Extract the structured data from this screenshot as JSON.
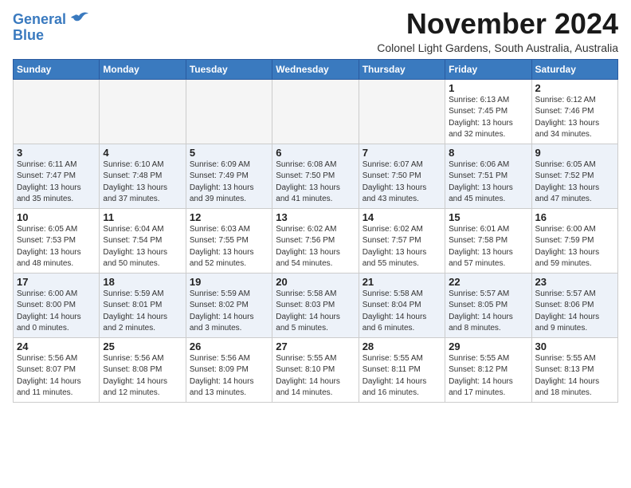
{
  "header": {
    "logo_line1": "General",
    "logo_line2": "Blue",
    "month": "November 2024",
    "location": "Colonel Light Gardens, South Australia, Australia"
  },
  "weekdays": [
    "Sunday",
    "Monday",
    "Tuesday",
    "Wednesday",
    "Thursday",
    "Friday",
    "Saturday"
  ],
  "weeks": [
    [
      {
        "day": "",
        "info": ""
      },
      {
        "day": "",
        "info": ""
      },
      {
        "day": "",
        "info": ""
      },
      {
        "day": "",
        "info": ""
      },
      {
        "day": "",
        "info": ""
      },
      {
        "day": "1",
        "info": "Sunrise: 6:13 AM\nSunset: 7:45 PM\nDaylight: 13 hours\nand 32 minutes."
      },
      {
        "day": "2",
        "info": "Sunrise: 6:12 AM\nSunset: 7:46 PM\nDaylight: 13 hours\nand 34 minutes."
      }
    ],
    [
      {
        "day": "3",
        "info": "Sunrise: 6:11 AM\nSunset: 7:47 PM\nDaylight: 13 hours\nand 35 minutes."
      },
      {
        "day": "4",
        "info": "Sunrise: 6:10 AM\nSunset: 7:48 PM\nDaylight: 13 hours\nand 37 minutes."
      },
      {
        "day": "5",
        "info": "Sunrise: 6:09 AM\nSunset: 7:49 PM\nDaylight: 13 hours\nand 39 minutes."
      },
      {
        "day": "6",
        "info": "Sunrise: 6:08 AM\nSunset: 7:50 PM\nDaylight: 13 hours\nand 41 minutes."
      },
      {
        "day": "7",
        "info": "Sunrise: 6:07 AM\nSunset: 7:50 PM\nDaylight: 13 hours\nand 43 minutes."
      },
      {
        "day": "8",
        "info": "Sunrise: 6:06 AM\nSunset: 7:51 PM\nDaylight: 13 hours\nand 45 minutes."
      },
      {
        "day": "9",
        "info": "Sunrise: 6:05 AM\nSunset: 7:52 PM\nDaylight: 13 hours\nand 47 minutes."
      }
    ],
    [
      {
        "day": "10",
        "info": "Sunrise: 6:05 AM\nSunset: 7:53 PM\nDaylight: 13 hours\nand 48 minutes."
      },
      {
        "day": "11",
        "info": "Sunrise: 6:04 AM\nSunset: 7:54 PM\nDaylight: 13 hours\nand 50 minutes."
      },
      {
        "day": "12",
        "info": "Sunrise: 6:03 AM\nSunset: 7:55 PM\nDaylight: 13 hours\nand 52 minutes."
      },
      {
        "day": "13",
        "info": "Sunrise: 6:02 AM\nSunset: 7:56 PM\nDaylight: 13 hours\nand 54 minutes."
      },
      {
        "day": "14",
        "info": "Sunrise: 6:02 AM\nSunset: 7:57 PM\nDaylight: 13 hours\nand 55 minutes."
      },
      {
        "day": "15",
        "info": "Sunrise: 6:01 AM\nSunset: 7:58 PM\nDaylight: 13 hours\nand 57 minutes."
      },
      {
        "day": "16",
        "info": "Sunrise: 6:00 AM\nSunset: 7:59 PM\nDaylight: 13 hours\nand 59 minutes."
      }
    ],
    [
      {
        "day": "17",
        "info": "Sunrise: 6:00 AM\nSunset: 8:00 PM\nDaylight: 14 hours\nand 0 minutes."
      },
      {
        "day": "18",
        "info": "Sunrise: 5:59 AM\nSunset: 8:01 PM\nDaylight: 14 hours\nand 2 minutes."
      },
      {
        "day": "19",
        "info": "Sunrise: 5:59 AM\nSunset: 8:02 PM\nDaylight: 14 hours\nand 3 minutes."
      },
      {
        "day": "20",
        "info": "Sunrise: 5:58 AM\nSunset: 8:03 PM\nDaylight: 14 hours\nand 5 minutes."
      },
      {
        "day": "21",
        "info": "Sunrise: 5:58 AM\nSunset: 8:04 PM\nDaylight: 14 hours\nand 6 minutes."
      },
      {
        "day": "22",
        "info": "Sunrise: 5:57 AM\nSunset: 8:05 PM\nDaylight: 14 hours\nand 8 minutes."
      },
      {
        "day": "23",
        "info": "Sunrise: 5:57 AM\nSunset: 8:06 PM\nDaylight: 14 hours\nand 9 minutes."
      }
    ],
    [
      {
        "day": "24",
        "info": "Sunrise: 5:56 AM\nSunset: 8:07 PM\nDaylight: 14 hours\nand 11 minutes."
      },
      {
        "day": "25",
        "info": "Sunrise: 5:56 AM\nSunset: 8:08 PM\nDaylight: 14 hours\nand 12 minutes."
      },
      {
        "day": "26",
        "info": "Sunrise: 5:56 AM\nSunset: 8:09 PM\nDaylight: 14 hours\nand 13 minutes."
      },
      {
        "day": "27",
        "info": "Sunrise: 5:55 AM\nSunset: 8:10 PM\nDaylight: 14 hours\nand 14 minutes."
      },
      {
        "day": "28",
        "info": "Sunrise: 5:55 AM\nSunset: 8:11 PM\nDaylight: 14 hours\nand 16 minutes."
      },
      {
        "day": "29",
        "info": "Sunrise: 5:55 AM\nSunset: 8:12 PM\nDaylight: 14 hours\nand 17 minutes."
      },
      {
        "day": "30",
        "info": "Sunrise: 5:55 AM\nSunset: 8:13 PM\nDaylight: 14 hours\nand 18 minutes."
      }
    ]
  ]
}
